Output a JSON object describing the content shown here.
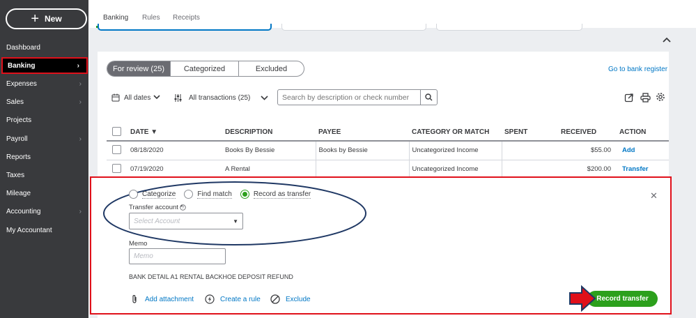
{
  "sidebar": {
    "new_label": "New",
    "items": [
      {
        "label": "Dashboard",
        "chevron": false
      },
      {
        "label": "Banking",
        "chevron": true,
        "active": true
      },
      {
        "label": "Expenses",
        "chevron": true
      },
      {
        "label": "Sales",
        "chevron": true
      },
      {
        "label": "Projects",
        "chevron": false
      },
      {
        "label": "Payroll",
        "chevron": true
      },
      {
        "label": "Reports",
        "chevron": false
      },
      {
        "label": "Taxes",
        "chevron": false
      },
      {
        "label": "Mileage",
        "chevron": false
      },
      {
        "label": "Accounting",
        "chevron": true
      },
      {
        "label": "My Accountant",
        "chevron": false
      }
    ]
  },
  "top_tabs": [
    "Banking",
    "Rules",
    "Receipts"
  ],
  "review_tabs": [
    "For review (25)",
    "Categorized",
    "Excluded"
  ],
  "bank_register_link": "Go to bank register",
  "filters": {
    "dates": "All dates",
    "transactions": "All transactions (25)",
    "search_placeholder": "Search by description or check number"
  },
  "table": {
    "headers": [
      "DATE ▼",
      "DESCRIPTION",
      "PAYEE",
      "CATEGORY OR MATCH",
      "SPENT",
      "RECEIVED",
      "ACTION"
    ],
    "rows": [
      {
        "date": "08/18/2020",
        "description": "Books By Bessie",
        "payee": "Books by Bessie",
        "category": "Uncategorized Income",
        "spent": "",
        "received": "$55.00",
        "action": "Add"
      },
      {
        "date": "07/19/2020",
        "description": "A Rental",
        "payee": "",
        "category": "Uncategorized Income",
        "spent": "",
        "received": "$200.00",
        "action": "Transfer"
      }
    ]
  },
  "detail": {
    "options": [
      "Categorize",
      "Find match",
      "Record as transfer"
    ],
    "selected_option": "Record as transfer",
    "transfer_label": "Transfer account *",
    "select_placeholder": "Select Account",
    "memo_label": "Memo",
    "memo_placeholder": "Memo",
    "bank_detail_label": "BANK DETAIL",
    "bank_detail_value": "A1 RENTAL BACKHOE DEPOSIT REFUND",
    "add_attachment": "Add attachment",
    "create_rule": "Create a rule",
    "exclude": "Exclude",
    "record_button": "Record transfer"
  },
  "colors": {
    "sidebar_bg": "#393a3d",
    "accent_green": "#2ca01c",
    "link_blue": "#0077c5",
    "highlight_red": "#e0101a",
    "ellipse_navy": "#1f3864"
  }
}
